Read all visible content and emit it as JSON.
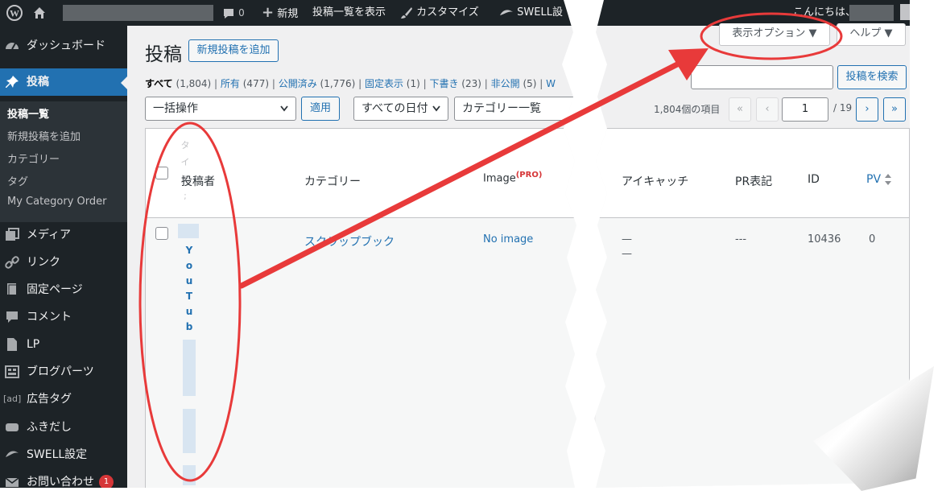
{
  "adminbar": {
    "comments_count": "0",
    "new_label": "新規",
    "view_posts_label": "投稿一覧を表示",
    "customize_label": "カスタマイズ",
    "swell_label": "SWELL設",
    "greeting": "こんにちは、"
  },
  "sidebar": {
    "items": [
      {
        "label": "ダッシュボード",
        "icon": "dashboard-icon"
      },
      {
        "label": "投稿",
        "icon": "pin-icon"
      },
      {
        "label": "メディア",
        "icon": "media-icon"
      },
      {
        "label": "リンク",
        "icon": "link-icon"
      },
      {
        "label": "固定ページ",
        "icon": "page-icon"
      },
      {
        "label": "コメント",
        "icon": "comment-icon"
      },
      {
        "label": "LP",
        "icon": "document-icon"
      },
      {
        "label": "ブログパーツ",
        "icon": "parts-icon"
      },
      {
        "label": "広告タグ",
        "icon": "ad-icon"
      },
      {
        "label": "ふきだし",
        "icon": "bubble-icon"
      },
      {
        "label": "SWELL設定",
        "icon": "swell-icon"
      },
      {
        "label": "お問い合わせ",
        "icon": "mail-icon",
        "badge": "1"
      }
    ],
    "ad_icon_text": "[ad]",
    "submenu": [
      "投稿一覧",
      "新規投稿を追加",
      "カテゴリー",
      "タグ",
      "My Category Order"
    ]
  },
  "main": {
    "title": "投稿",
    "add_new": "新規投稿を追加",
    "screen_options": "表示オプション ▼",
    "help": "ヘルプ ▼",
    "search_button": "投稿を検索",
    "search_value": "",
    "filters": [
      {
        "label": "すべて",
        "count": "(1,804)"
      },
      {
        "label": "所有",
        "count": "(477)"
      },
      {
        "label": "公開済み",
        "count": "(1,776)"
      },
      {
        "label": "固定表示",
        "count": "(1)"
      },
      {
        "label": "下書き",
        "count": "(23)"
      },
      {
        "label": "非公開",
        "count": "(5)"
      },
      {
        "label": "W",
        "count": ""
      }
    ],
    "bulk_action": "一括操作",
    "apply": "適用",
    "date_filter": "すべての日付",
    "category_filter": "カテゴリー一覧",
    "item_count": "1,804個の項目",
    "pagination": {
      "first": "«",
      "prev": "‹",
      "current": "1",
      "total": "/ 19",
      "next": "›",
      "last": "»"
    }
  },
  "table": {
    "headers": {
      "title_partial": "タ イ 川 ;",
      "author": "投稿者",
      "category": "カテゴリー",
      "image": "Image",
      "image_pro": "(PRO)",
      "eyecatch": "アイキャッチ",
      "pr": "PR表記",
      "id": "ID",
      "pv": "PV"
    },
    "row": {
      "title_vertical": [
        "Y",
        "o",
        "u",
        "T",
        "u",
        "b"
      ],
      "category": "スクラップブック",
      "image": "No image",
      "eyecatch": "—",
      "eyecatch2": "—",
      "pr": "---",
      "id": "10436",
      "pv": "0"
    }
  },
  "colors": {
    "admin_dark": "#1d2327",
    "wp_blue": "#2271b1",
    "annotation_red": "#e83a3a"
  }
}
